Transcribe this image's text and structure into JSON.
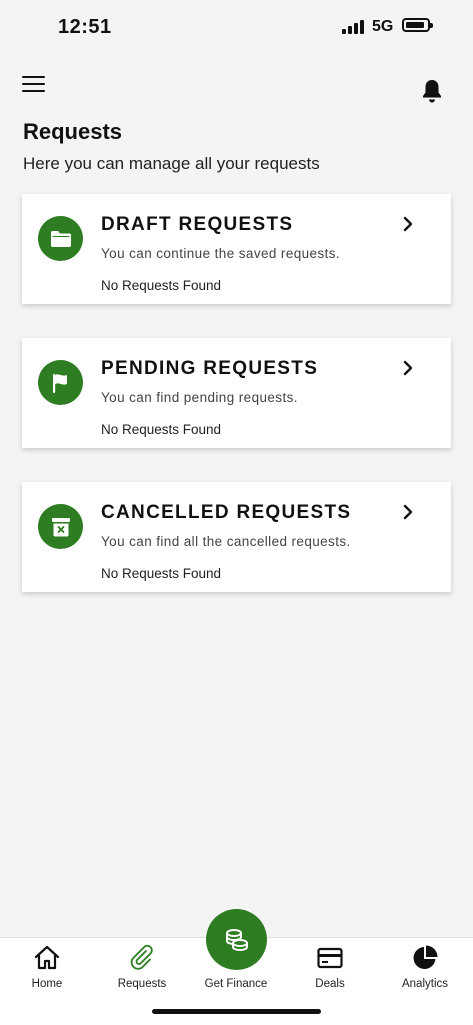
{
  "status_bar": {
    "time": "12:51",
    "network": "5G"
  },
  "header": {
    "title": "Requests",
    "subtitle": "Here you can manage all your requests"
  },
  "cards": [
    {
      "title": "DRAFT REQUESTS",
      "description": "You can continue the saved requests.",
      "count_text": "No Requests Found",
      "icon": "folder-icon"
    },
    {
      "title": "PENDING REQUESTS",
      "description": "You can find pending requests.",
      "count_text": "No Requests Found",
      "icon": "flag-icon"
    },
    {
      "title": "CANCELLED REQUESTS",
      "description": "You can find all the cancelled requests.",
      "count_text": "No Requests Found",
      "icon": "cancelled-bin-icon"
    }
  ],
  "bottom_nav": {
    "items": [
      {
        "label": "Home",
        "icon": "home-icon"
      },
      {
        "label": "Requests",
        "icon": "paperclip-icon"
      },
      {
        "label": "Get Finance",
        "icon": "coins-icon"
      },
      {
        "label": "Deals",
        "icon": "card-icon"
      },
      {
        "label": "Analytics",
        "icon": "pie-chart-icon"
      }
    ]
  },
  "colors": {
    "accent": "#2e7d22",
    "background": "#f4f4f4",
    "card": "#ffffff"
  }
}
